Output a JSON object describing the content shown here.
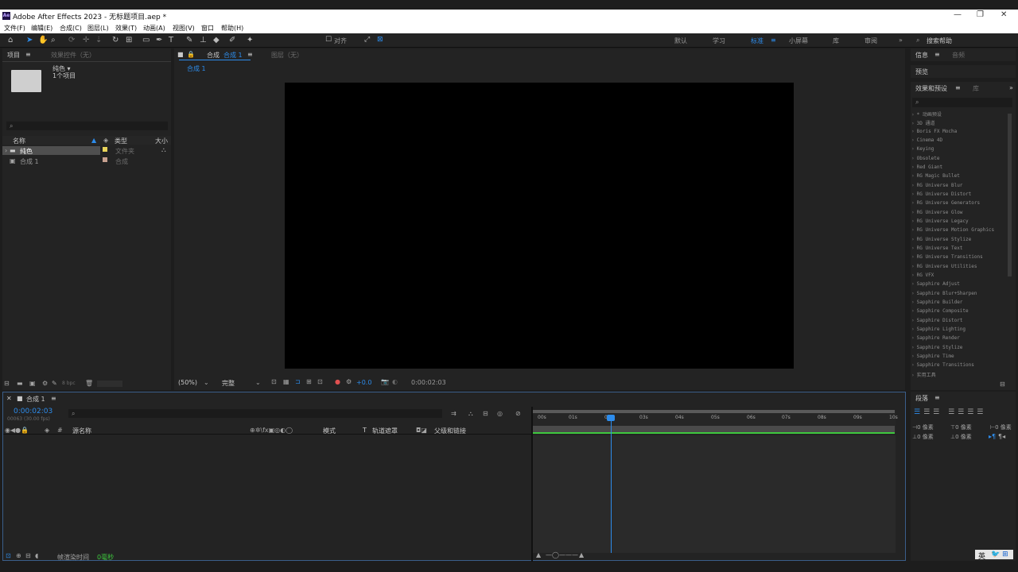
{
  "window": {
    "title": "Adobe After Effects 2023 - 无标题项目.aep *",
    "app_icon": "Ae"
  },
  "menu": [
    "文件(F)",
    "编辑(E)",
    "合成(C)",
    "图层(L)",
    "效果(T)",
    "动画(A)",
    "视图(V)",
    "窗口",
    "帮助(H)"
  ],
  "toolbar": {
    "align": "对齐",
    "workspaces": [
      "默认",
      "学习",
      "标准",
      "小屏幕",
      "库",
      "审阅"
    ],
    "search_help": "搜索帮助"
  },
  "project": {
    "tab": "项目",
    "tab2": "效果控件（无）",
    "folder_name": "纯色 ▾",
    "folder_count": "1个项目",
    "cols": {
      "name": "名称",
      "type": "类型",
      "size": "大小"
    },
    "rows": [
      {
        "name": "纯色",
        "type": "文件夹",
        "color": "#e8d35a"
      },
      {
        "name": "合成 1",
        "type": "合成",
        "color": "#c7a08f"
      }
    ],
    "bpc": "8 bpc"
  },
  "comp": {
    "tab": "合成",
    "tab_active": "合成 1",
    "layer_tab": "图层（无）",
    "breadcrumb": "合成 1",
    "zoom": "(50%)",
    "res": "完整",
    "exposure": "+0.0",
    "timecode": "0:00:02:03"
  },
  "info": {
    "tab": "信息",
    "tab2": "音频",
    "preview": "预览",
    "effects": "效果和预设",
    "lib": "库",
    "effects_list": [
      "* 动画预设",
      "3D 通道",
      "Boris FX Mocha",
      "Cinema 4D",
      "Keying",
      "Obsolete",
      "Red Giant",
      "RG Magic Bullet",
      "RG Universe Blur",
      "RG Universe Distort",
      "RG Universe Generators",
      "RG Universe Glow",
      "RG Universe Legacy",
      "RG Universe Motion Graphics",
      "RG Universe Stylize",
      "RG Universe Text",
      "RG Universe Transitions",
      "RG Universe Utilities",
      "RG VFX",
      "Sapphire Adjust",
      "Sapphire Blur+Sharpen",
      "Sapphire Builder",
      "Sapphire Composite",
      "Sapphire Distort",
      "Sapphire Lighting",
      "Sapphire Render",
      "Sapphire Stylize",
      "Sapphire Time",
      "Sapphire Transitions",
      "实用工具"
    ]
  },
  "timeline": {
    "tab": "合成 1",
    "timecode": "0:00:02:03",
    "frames": "00063 (30.00 fps)",
    "cols": {
      "source": "源名称",
      "mode": "模式",
      "t": "T",
      "track": "轨道遮罩",
      "parent": "父级和链接"
    },
    "ticks": [
      "00s",
      "01s",
      "02s",
      "03s",
      "04s",
      "05s",
      "06s",
      "07s",
      "08s",
      "09s",
      "10s"
    ],
    "render_label": "帧渲染时间",
    "render_value": "0毫秒"
  },
  "paragraph": {
    "tab": "段落",
    "vals": [
      "0 像素",
      "0 像素",
      "0 像素",
      "0 像素",
      "0 像素"
    ]
  },
  "ime": "英"
}
